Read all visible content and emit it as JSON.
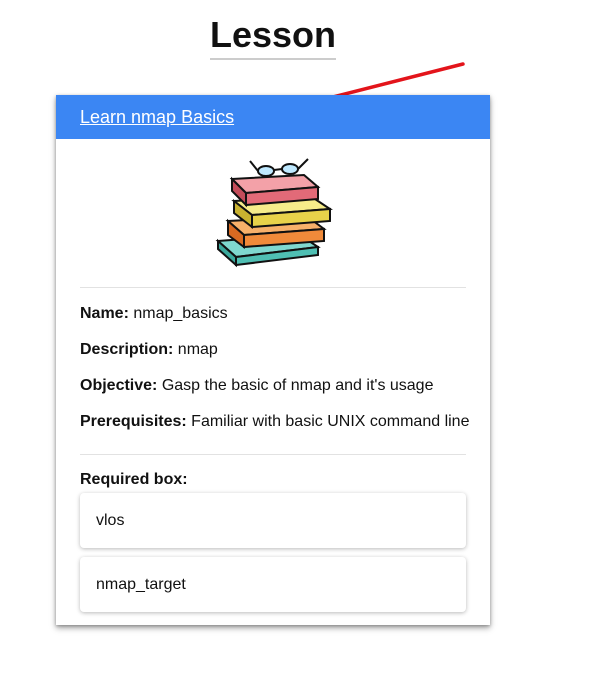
{
  "page": {
    "title": "Lesson"
  },
  "lesson": {
    "link_text": "Learn nmap Basics",
    "image_icon": "books-stack-icon",
    "fields": [
      {
        "label": "Name:",
        "value": "nmap_basics"
      },
      {
        "label": "Description:",
        "value": "nmap"
      },
      {
        "label": "Objective:",
        "value": "Gasp the basic of nmap and it's usage"
      },
      {
        "label": "Prerequisites:",
        "value": "Familiar with basic UNIX command line"
      }
    ],
    "required_box_label": "Required box:",
    "boxes": [
      "vlos",
      "nmap_target"
    ]
  },
  "colors": {
    "header": "#3b86f3",
    "arrow": "#e3141b"
  }
}
